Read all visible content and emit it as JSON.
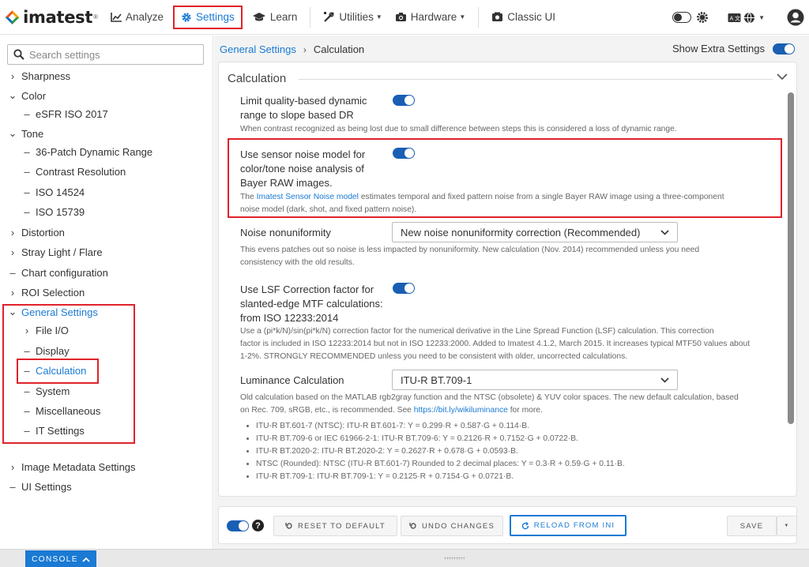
{
  "app": {
    "name": "imatest",
    "reg": "®"
  },
  "nav": {
    "analyze": "Analyze",
    "settings": "Settings",
    "learn": "Learn",
    "utilities": "Utilities",
    "hardware": "Hardware",
    "classic": "Classic UI"
  },
  "colors": {
    "accent": "#1a7ad4",
    "highlight": "#e0222b",
    "toggle": "#1a5fb4"
  },
  "sidebar": {
    "search_placeholder": "Search settings",
    "items": [
      {
        "label": "Sharpness",
        "glyph": "›"
      },
      {
        "label": "Color",
        "glyph": "⌄"
      },
      {
        "label": "eSFR ISO 2017",
        "glyph": "–"
      },
      {
        "label": "Tone",
        "glyph": "⌄"
      },
      {
        "label": "36-Patch Dynamic Range",
        "glyph": "–"
      },
      {
        "label": "Contrast Resolution",
        "glyph": "–"
      },
      {
        "label": "ISO 14524",
        "glyph": "–"
      },
      {
        "label": "ISO 15739",
        "glyph": "–"
      },
      {
        "label": "Distortion",
        "glyph": "›"
      },
      {
        "label": "Stray Light / Flare",
        "glyph": "›"
      },
      {
        "label": "Chart configuration",
        "glyph": "–"
      },
      {
        "label": "ROI Selection",
        "glyph": "›"
      },
      {
        "label": "General Settings",
        "glyph": "⌄"
      },
      {
        "label": "File I/O",
        "glyph": "›"
      },
      {
        "label": "Display",
        "glyph": "–"
      },
      {
        "label": "Calculation",
        "glyph": "–"
      },
      {
        "label": "System",
        "glyph": "–"
      },
      {
        "label": "Miscellaneous",
        "glyph": "–"
      },
      {
        "label": "IT Settings",
        "glyph": "–"
      },
      {
        "label": "Image Metadata Settings",
        "glyph": "›"
      },
      {
        "label": "UI Settings",
        "glyph": "–"
      }
    ]
  },
  "breadcrumb": {
    "parent": "General Settings",
    "current": "Calculation"
  },
  "show_extra": "Show Extra Settings",
  "panel": {
    "title": "Calculation",
    "s1": {
      "label1": "Limit quality-based dynamic",
      "label2": "range to slope based DR",
      "desc": "When contrast recognized as being lost due to small difference between steps this is considered a loss of dynamic range."
    },
    "s2": {
      "label1": "Use sensor noise model for",
      "label2": "color/tone noise analysis of",
      "label3": "Bayer RAW images.",
      "desc_pre": "The ",
      "desc_link": "Imatest Sensor Noise model",
      "desc_post1": " estimates temporal and fixed pattern noise from a single Bayer RAW image using a three-component",
      "desc_post2": "noise model (dark, shot, and fixed pattern noise)."
    },
    "s3": {
      "label": "Noise nonuniformity",
      "value": "New noise nonuniformity correction (Recommended)",
      "desc1": "This evens patches out so noise is less impacted by nonuniformity. New calculation (Nov. 2014) recommended unless you need",
      "desc2": "consistency with the old results."
    },
    "s4": {
      "label1": "Use LSF Correction factor for",
      "label2": "slanted-edge MTF calculations:",
      "label3": "from ISO 12233:2014",
      "desc1": "Use a (pi*k/N)/sin(pi*k/N) correction factor for the numerical derivative in the Line Spread Function (LSF) calculation. This correction",
      "desc2": "factor is included in ISO 12233:2014 but not in ISO 12233:2000. Added to Imatest 4.1.2, March 2015. It increases typical MTF50 values about",
      "desc3": "1-2%. STRONGLY RECOMMENDED unless you need to be consistent with older, uncorrected calculations."
    },
    "s5": {
      "label": "Luminance Calculation",
      "value": "ITU-R BT.709-1",
      "desc1": "Old calculation based on the MATLAB rgb2gray function and the NTSC (obsolete) & YUV color spaces. The new default calculation, based",
      "desc2_pre": "on Rec. 709, sRGB, etc., is recommended. See ",
      "desc2_link": "https://bit.ly/wikiluminance",
      "desc2_post": " for more.",
      "bullets": [
        "ITU-R BT.601-7 (NTSC): ITU-R BT.601-7: Y = 0.299·R + 0.587·G + 0.114·B.",
        "ITU-R BT.709-6 or IEC 61966-2-1: ITU-R BT.709-6: Y = 0.2126·R + 0.7152·G + 0.0722·B.",
        "ITU-R BT.2020-2: ITU-R BT.2020-2: Y = 0.2627·R + 0.678·G + 0.0593·B.",
        "NTSC (Rounded): NTSC (ITU-R BT.601-7) Rounded to 2 decimal places: Y = 0.3·R + 0.59·G + 0.11·B.",
        "ITU-R BT.709-1: ITU-R BT.709-1: Y = 0.2125·R + 0.7154·G + 0.0721·B."
      ]
    }
  },
  "buttons": {
    "reset": "RESET TO DEFAULT",
    "undo": "UNDO CHANGES",
    "reload": "RELOAD FROM INI",
    "save": "SAVE"
  },
  "console": "CONSOLE"
}
